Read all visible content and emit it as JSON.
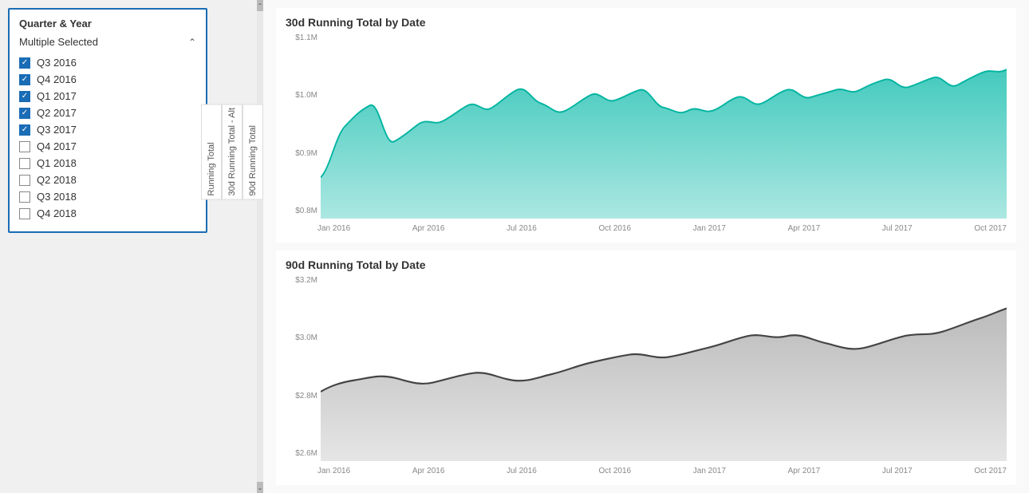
{
  "filter": {
    "title": "Quarter & Year",
    "dropdown_label": "Multiple Selected",
    "items": [
      {
        "label": "Q3 2016",
        "state": "checked"
      },
      {
        "label": "Q4 2016",
        "state": "checked"
      },
      {
        "label": "Q1 2017",
        "state": "checked"
      },
      {
        "label": "Q2 2017",
        "state": "checked"
      },
      {
        "label": "Q3 2017",
        "state": "checked"
      },
      {
        "label": "Q4 2017",
        "state": "partial"
      },
      {
        "label": "Q1 2018",
        "state": "unchecked"
      },
      {
        "label": "Q2 2018",
        "state": "unchecked"
      },
      {
        "label": "Q3 2018",
        "state": "unchecked"
      },
      {
        "label": "Q4 2018",
        "state": "unchecked"
      }
    ]
  },
  "tabs": [
    {
      "label": "Running Total",
      "active": false
    },
    {
      "label": "30d Running Total - Alt",
      "active": false
    },
    {
      "label": "90d Running Total",
      "active": false
    }
  ],
  "chart1": {
    "title": "30d Running Total by Date",
    "y_labels": [
      "$1.1M",
      "$1.0M",
      "$0.9M",
      "$0.8M"
    ],
    "x_labels": [
      "Jan 2016",
      "Apr 2016",
      "Jul 2016",
      "Oct 2016",
      "Jan 2017",
      "Apr 2017",
      "Jul 2017",
      "Oct 2017"
    ],
    "color": "#2ec4b6",
    "accent": "#00b4a0"
  },
  "chart2": {
    "title": "90d Running Total by Date",
    "y_labels": [
      "$3.2M",
      "$3.0M",
      "$2.8M",
      "$2.6M"
    ],
    "x_labels": [
      "Jan 2016",
      "Apr 2016",
      "Jul 2016",
      "Oct 2016",
      "Jan 2017",
      "Apr 2017",
      "Jul 2017",
      "Oct 2017"
    ],
    "color": "#888888",
    "accent": "#555555"
  }
}
